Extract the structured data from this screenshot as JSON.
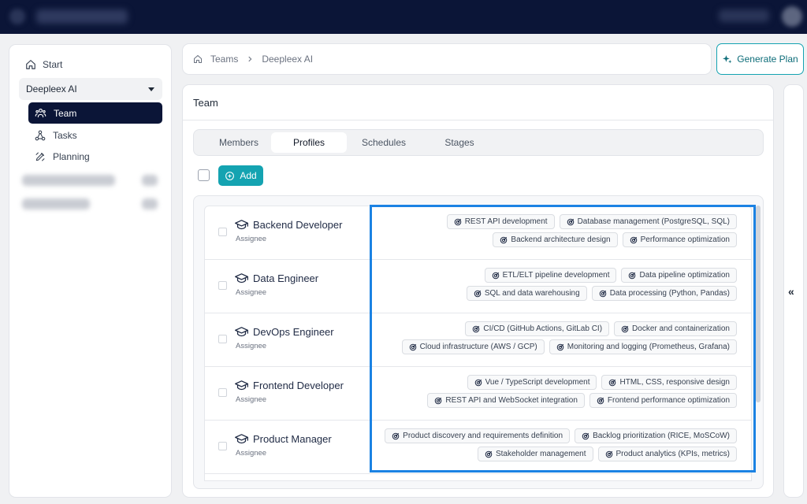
{
  "sidebar": {
    "start_label": "Start",
    "org": "Deepleex AI",
    "items": [
      {
        "label": "Team",
        "icon": "team-icon",
        "active": true
      },
      {
        "label": "Tasks",
        "icon": "tasks-icon",
        "active": false
      },
      {
        "label": "Planning",
        "icon": "planning-icon",
        "active": false
      }
    ]
  },
  "breadcrumb": {
    "home_icon": "home-icon",
    "items": [
      "Teams",
      "Deepleex AI"
    ]
  },
  "header": {
    "generate_plan_label": "Generate Plan"
  },
  "main": {
    "title": "Team",
    "tabs": [
      {
        "label": "Members",
        "active": false
      },
      {
        "label": "Profiles",
        "active": true
      },
      {
        "label": "Schedules",
        "active": false
      },
      {
        "label": "Stages",
        "active": false
      }
    ],
    "add_label": "Add",
    "profiles": [
      {
        "title": "Backend Developer",
        "subtitle": "Assignee",
        "skills": [
          "REST API development",
          "Database management (PostgreSQL, SQL)",
          "Backend architecture design",
          "Performance optimization"
        ]
      },
      {
        "title": "Data Engineer",
        "subtitle": "Assignee",
        "skills": [
          "ETL/ELT pipeline development",
          "Data pipeline optimization",
          "SQL and data warehousing",
          "Data processing (Python, Pandas)"
        ]
      },
      {
        "title": "DevOps Engineer",
        "subtitle": "Assignee",
        "skills": [
          "CI/CD (GitHub Actions, GitLab CI)",
          "Docker and containerization",
          "Cloud infrastructure (AWS / GCP)",
          "Monitoring and logging (Prometheus, Grafana)"
        ]
      },
      {
        "title": "Frontend Developer",
        "subtitle": "Assignee",
        "skills": [
          "Vue / TypeScript development",
          "HTML, CSS, responsive design",
          "REST API and WebSocket integration",
          "Frontend performance optimization"
        ]
      },
      {
        "title": "Product Manager",
        "subtitle": "Assignee",
        "skills": [
          "Product discovery and requirements definition",
          "Backlog prioritization (RICE, MoSCoW)",
          "Stakeholder management",
          "Product analytics (KPIs, metrics)"
        ]
      }
    ]
  },
  "right_panel": {
    "collapse_label": "«"
  },
  "colors": {
    "topbar": "#0b1537",
    "accent": "#14a3b1",
    "highlight": "#1b82e3"
  }
}
